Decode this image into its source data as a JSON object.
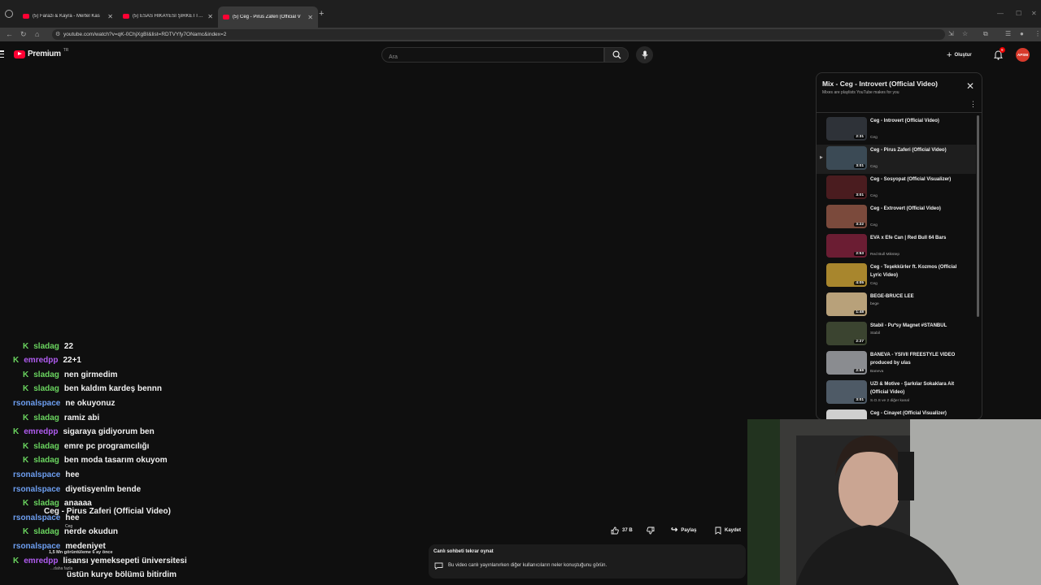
{
  "browser": {
    "tabs": [
      {
        "title": "(5) Farazi & Kayra - Mertel Kas",
        "active": false
      },
      {
        "title": "(5) ESAS HİKAYESİ ŞİRKETTİR 2",
        "active": false
      },
      {
        "title": "(5) Ceg - Pirus Zaferi (Official V",
        "active": true
      }
    ],
    "url": "youtube.com/watch?v=qK-0ChjXgBI&list=RDTVYfy7ONamc&index=2"
  },
  "masthead": {
    "brand": "Premium",
    "country": "TR",
    "search_placeholder": "Ara",
    "create_label": "Oluştur",
    "notification_count": "9",
    "avatar_text": "APSM"
  },
  "playlist": {
    "title": "Mix - Ceg - Introvert (Official Video)",
    "subtitle": "Mixes are playlists YouTube makes for you",
    "items": [
      {
        "title": "Ceg - Introvert (Official Video)",
        "channel": "Ceg",
        "duration": "2:31",
        "index": "",
        "thumb_color": "#2e3238"
      },
      {
        "title": "Ceg - Pirus Zaferi (Official Video)",
        "channel": "Ceg",
        "duration": "3:01",
        "index": "▶",
        "thumb_color": "#3b4a55"
      },
      {
        "title": "Ceg - Sosyopat (Official Visualizer)",
        "channel": "Ceg",
        "duration": "3:01",
        "index": "",
        "thumb_color": "#4a1c1f"
      },
      {
        "title": "Ceg - Extrovert (Official Video)",
        "channel": "Ceg",
        "duration": "3:22",
        "index": "",
        "thumb_color": "#7b4a3c"
      },
      {
        "title": "EVA x Efe Can | Red Bull 64 Bars",
        "channel": "Red Bull Mikstep",
        "duration": "2:53",
        "index": "",
        "thumb_color": "#6b1d33"
      },
      {
        "title": "Ceg - Teşekkürler ft. Kozmos (Official Lyric Video)",
        "channel": "Ceg",
        "duration": "4:05",
        "index": "",
        "thumb_color": "#a8862d"
      },
      {
        "title": "BEGE-BRUCE LEE",
        "channel": "bege",
        "duration": "1:48",
        "index": "",
        "thumb_color": "#b8a17a"
      },
      {
        "title": "Stabil - Pu*sy Magnet #STANBUL",
        "channel": "Stabil",
        "duration": "2:27",
        "index": "",
        "thumb_color": "#3b4430"
      },
      {
        "title": "BANEVA - YSIVII FREESTYLE VIDEO produced by ulas",
        "channel": "Baneva",
        "duration": "2:59",
        "index": "",
        "thumb_color": "#8a8c90"
      },
      {
        "title": "UZI & Motive - Şarkılar Sokaklara Ait (Official Video)",
        "channel": "S.O.S ve 2 diğer kanal",
        "duration": "3:01",
        "index": "",
        "thumb_color": "#4e5a66"
      },
      {
        "title": "Ceg - Cinayet (Official Visualizer)",
        "channel": "",
        "duration": "2:39",
        "index": "",
        "thumb_color": "#cfcfcf"
      }
    ]
  },
  "chat": [
    {
      "user": "sladag",
      "message": "22",
      "badge": true,
      "color": "#6ad45f"
    },
    {
      "user": "emredpp",
      "message": "22+1",
      "badge": true,
      "color": "#b05cf0"
    },
    {
      "user": "sladag",
      "message": "nen girmedim",
      "badge": true,
      "color": "#6ad45f"
    },
    {
      "user": "sladag",
      "message": "ben kaldım kardeş bennn",
      "badge": true,
      "color": "#6ad45f"
    },
    {
      "user": "rsonalspace",
      "message": "ne okuyonuz",
      "badge": false,
      "color": "#6d9ef0"
    },
    {
      "user": "sladag",
      "message": "ramiz abi",
      "badge": true,
      "color": "#6ad45f"
    },
    {
      "user": "emredpp",
      "message": "sigaraya gidiyorum ben",
      "badge": true,
      "color": "#b05cf0"
    },
    {
      "user": "sladag",
      "message": "emre pc programcılığı",
      "badge": true,
      "color": "#6ad45f"
    },
    {
      "user": "sladag",
      "message": "ben moda tasarım okuyom",
      "badge": true,
      "color": "#6ad45f"
    },
    {
      "user": "rsonalspace",
      "message": "hee",
      "badge": false,
      "color": "#6d9ef0"
    },
    {
      "user": "rsonalspace",
      "message": "diyetisyenlm bende",
      "badge": false,
      "color": "#6d9ef0"
    },
    {
      "user": "sladag",
      "message": "anaaaa",
      "badge": true,
      "color": "#6ad45f"
    },
    {
      "user": "rsonalspace",
      "message": "hee",
      "badge": false,
      "color": "#6d9ef0"
    },
    {
      "user": "sladag",
      "message": "nerde okudun",
      "badge": true,
      "color": "#6ad45f"
    },
    {
      "user": "rsonalspace",
      "message": "medeniyet",
      "badge": false,
      "color": "#6d9ef0"
    },
    {
      "user": "emredpp",
      "message": "lisansı yemeksepeti üniversitesi",
      "badge": true,
      "color": "#b05cf0"
    },
    {
      "user": "",
      "message": "üstün kurye bölümü bitirdim",
      "badge": false,
      "color": "#6d9ef0"
    }
  ],
  "video": {
    "title": "Ceg - Pirus Zaferi (Official Video)",
    "channel": "Ceg",
    "views": "1,5 Mn görüntüleme  6 ay önce",
    "more": "...daha fazla",
    "likes": "37 B",
    "share_label": "Paylaş",
    "save_label": "Kaydet"
  },
  "chat_replay": {
    "title": "Canlı sohbeti tekrar oynat",
    "description": "Bu video canlı yayınlanırken diğer kullanıcıların neler konuştuğunu görün."
  }
}
